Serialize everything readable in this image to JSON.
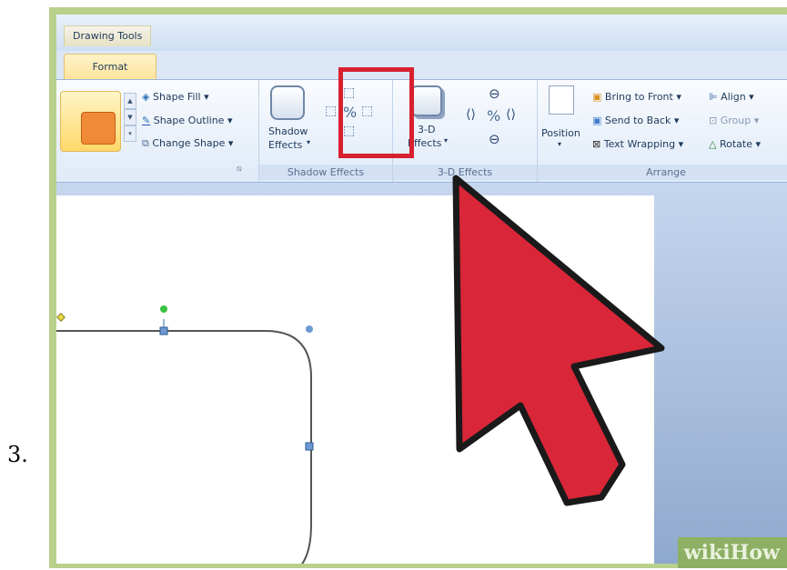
{
  "step_number": "3.",
  "ribbon": {
    "context_label": "Drawing Tools",
    "active_tab": "Format",
    "shape_styles": {
      "fill": "Shape Fill",
      "outline": "Shape Outline",
      "change": "Change Shape",
      "swatch_color": "#f08a37"
    },
    "shadow_effects": {
      "button_line1": "Shadow",
      "button_line2": "Effects",
      "group_label": "Shadow Effects"
    },
    "three_d_effects": {
      "button_line1": "3-D",
      "button_line2": "Effects",
      "group_label": "3-D Effects"
    },
    "arrange": {
      "position": "Position",
      "bring_to_front": "Bring to Front",
      "send_to_back": "Send to Back",
      "text_wrapping": "Text Wrapping",
      "align": "Align",
      "group": "Group",
      "rotate": "Rotate",
      "group_label": "Arrange"
    }
  },
  "colors": {
    "highlight": "#d9202f",
    "cursor_fill": "#d92638",
    "frame": "#b9cf8c"
  },
  "watermark": "wikiHow"
}
